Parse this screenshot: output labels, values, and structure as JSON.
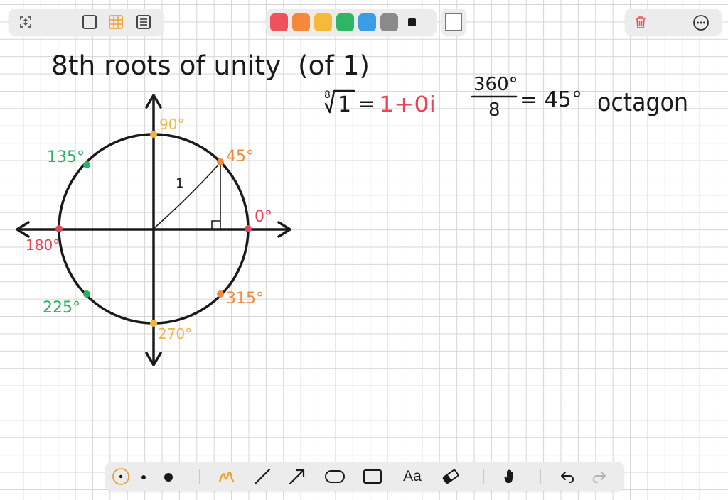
{
  "toolbar_top": {
    "left_icons": [
      "fullscreen-toggle-icon",
      "blank-paper-icon",
      "grid-paper-icon",
      "lined-paper-icon"
    ],
    "colors": [
      "#f0525c",
      "#f4893b",
      "#f6b93b",
      "#2fb565",
      "#3a9de6",
      "#8a8a8a"
    ],
    "selected_color": "#1a1a1a",
    "right_icons": [
      "trash-icon",
      "more-icon"
    ]
  },
  "toolbar_bottom": {
    "tools": [
      "pointer-tool",
      "small-dot-size",
      "large-dot-size",
      "highlighter-tool",
      "line-tool",
      "arrow-tool",
      "ellipse-tool",
      "rectangle-tool",
      "text-tool",
      "eraser-tool",
      "hand-tool",
      "undo",
      "redo"
    ],
    "text_tool_label": "Aa"
  },
  "note": {
    "title": "8th roots of unity  (of 1)",
    "root_index": "8",
    "root_radicand": "1",
    "equals": "=",
    "root_result": "1+0i",
    "fraction_numerator": "360°",
    "fraction_denominator": "8",
    "fraction_result": "= 45°",
    "shape_word": "octagon",
    "triangle_side_label": "1",
    "angle_labels": {
      "a0": "0°",
      "a45": "45°",
      "a90": "90°",
      "a135": "135°",
      "a180": "180°",
      "a225": "225°",
      "a270": "270°",
      "a315": "315°"
    }
  },
  "colors": {
    "ink": "#1a1a1a",
    "red": "#e8455a",
    "orange": "#f2883a",
    "yellow": "#f4b53c",
    "green": "#27b25f",
    "accent": "#f0a030"
  }
}
